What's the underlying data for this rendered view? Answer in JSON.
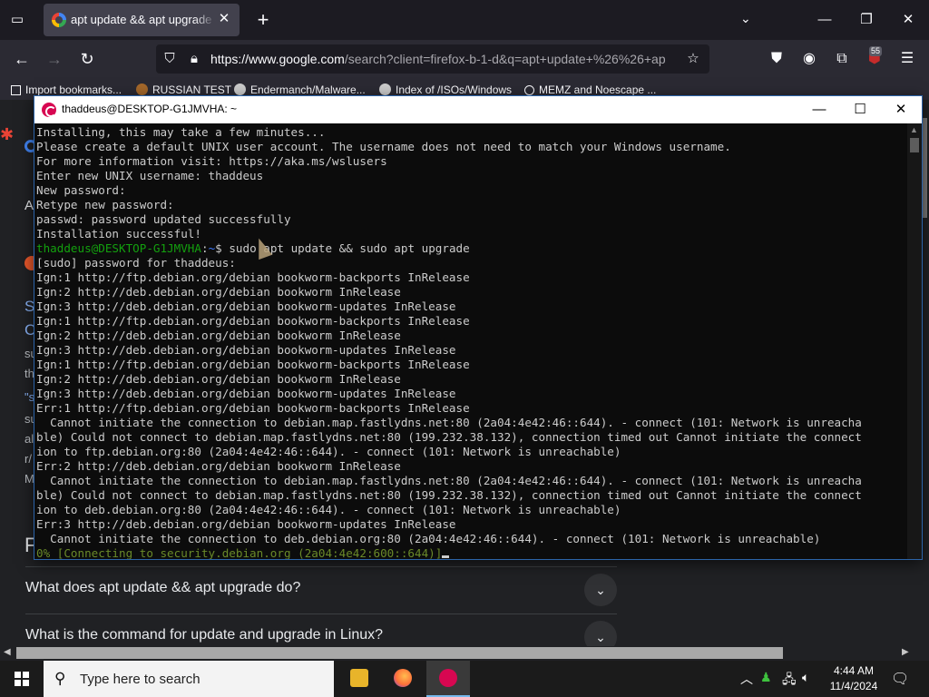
{
  "browser": {
    "tab_title": "apt update && apt upgrade - G",
    "url_main": "https://www.google.com",
    "url_rest": "/search?client=firefox-b-1-d&q=apt+update+%26%26+ap",
    "extension_badge": "55",
    "bookmarks": [
      "Import bookmarks...",
      "RUSSIAN TEST",
      "Endermanch/Malware...",
      "Index of /ISOs/Windows",
      "MEMZ and Noescape ..."
    ]
  },
  "page": {
    "left_fragments": [
      "A",
      "S",
      "C",
      "su",
      "th",
      "\"s",
      "su",
      "al",
      "r/",
      "M",
      "F"
    ],
    "faq": [
      "What does apt update && apt upgrade do?",
      "What is the command for update and upgrade in Linux?"
    ]
  },
  "terminal": {
    "title": "thaddeus@DESKTOP-G1JMVHA: ~",
    "lines": [
      "Installing, this may take a few minutes...",
      "Please create a default UNIX user account. The username does not need to match your Windows username.",
      "For more information visit: https://aka.ms/wslusers",
      "Enter new UNIX username: thaddeus",
      "New password:",
      "Retype new password:",
      "passwd: password updated successfully",
      "Installation successful!"
    ],
    "prompt_user": "thaddeus@DESKTOP-G1JMVHA",
    "prompt_sep": ":",
    "prompt_path": "~",
    "prompt_cmd": "$ sudo apt update && sudo apt upgrade",
    "output": [
      "[sudo] password for thaddeus:",
      "Ign:1 http://ftp.debian.org/debian bookworm-backports InRelease",
      "Ign:2 http://deb.debian.org/debian bookworm InRelease",
      "Ign:3 http://deb.debian.org/debian bookworm-updates InRelease",
      "Ign:1 http://ftp.debian.org/debian bookworm-backports InRelease",
      "Ign:2 http://deb.debian.org/debian bookworm InRelease",
      "Ign:3 http://deb.debian.org/debian bookworm-updates InRelease",
      "Ign:1 http://ftp.debian.org/debian bookworm-backports InRelease",
      "Ign:2 http://deb.debian.org/debian bookworm InRelease",
      "Ign:3 http://deb.debian.org/debian bookworm-updates InRelease",
      "Err:1 http://ftp.debian.org/debian bookworm-backports InRelease",
      "  Cannot initiate the connection to debian.map.fastlydns.net:80 (2a04:4e42:46::644). - connect (101: Network is unreacha",
      "ble) Could not connect to debian.map.fastlydns.net:80 (199.232.38.132), connection timed out Cannot initiate the connect",
      "ion to ftp.debian.org:80 (2a04:4e42:46::644). - connect (101: Network is unreachable)",
      "Err:2 http://deb.debian.org/debian bookworm InRelease",
      "  Cannot initiate the connection to debian.map.fastlydns.net:80 (2a04:4e42:46::644). - connect (101: Network is unreacha",
      "ble) Could not connect to debian.map.fastlydns.net:80 (199.232.38.132), connection timed out Cannot initiate the connect",
      "ion to deb.debian.org:80 (2a04:4e42:46::644). - connect (101: Network is unreachable)",
      "Err:3 http://deb.debian.org/debian bookworm-updates InRelease",
      "  Cannot initiate the connection to deb.debian.org:80 (2a04:4e42:46::644). - connect (101: Network is unreachable)"
    ],
    "progress_line": "0% [Connecting to security.debian.org (2a04:4e42:600::644)]"
  },
  "taskbar": {
    "search_placeholder": "Type here to search",
    "time": "4:44 AM",
    "date": "11/4/2024"
  },
  "colors": {
    "terminal_bg": "#0c0c0c",
    "prompt_green": "#13a10e",
    "prompt_blue": "#3b78ff",
    "firefox_bg": "#1c1b22"
  }
}
